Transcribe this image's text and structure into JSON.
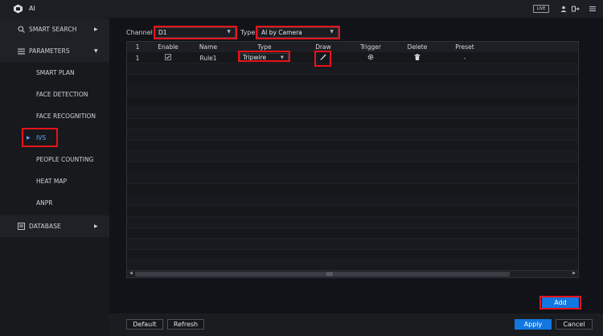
{
  "app": {
    "title": "AI",
    "live_label": "LIVE"
  },
  "sidebar": {
    "items": [
      {
        "label": "SMART SEARCH",
        "icon": "search-icon"
      },
      {
        "label": "PARAMETERS",
        "icon": "list-icon"
      },
      {
        "label": "DATABASE",
        "icon": "database-icon"
      }
    ],
    "sub_items": [
      {
        "label": "SMART PLAN"
      },
      {
        "label": "FACE DETECTION"
      },
      {
        "label": "FACE RECOGNITION"
      },
      {
        "label": "IVS"
      },
      {
        "label": "PEOPLE COUNTING"
      },
      {
        "label": "HEAT MAP"
      },
      {
        "label": "ANPR"
      }
    ]
  },
  "filters": {
    "channel_label": "Channel",
    "channel_value": "D1",
    "type_label": "Type",
    "type_value": "AI by Camera"
  },
  "table": {
    "headers": [
      "1",
      "Enable",
      "Name",
      "Type",
      "Draw",
      "Trigger",
      "Delete",
      "Preset"
    ],
    "rows": [
      {
        "index": "1",
        "enabled": true,
        "name": "Rule1",
        "type": "Tripwire",
        "preset": "-"
      }
    ]
  },
  "actions": {
    "add_label": "Add"
  },
  "footer": {
    "default_label": "Default",
    "refresh_label": "Refresh",
    "apply_label": "Apply",
    "cancel_label": "Cancel"
  },
  "colors": {
    "accent": "#1277e1",
    "highlight": "#e8131b",
    "active_text": "#5aa9ff"
  }
}
